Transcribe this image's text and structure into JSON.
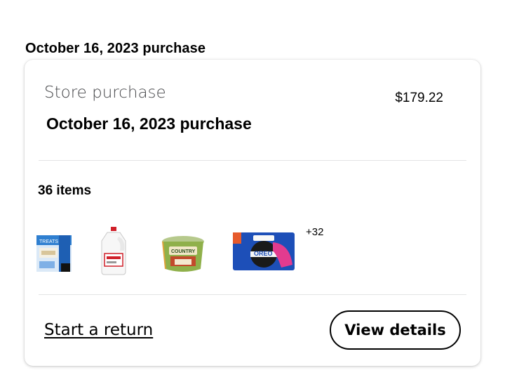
{
  "section": {
    "heading": "October 16, 2023 purchase"
  },
  "order": {
    "purchase_type": "Store purchase",
    "total": "$179.22",
    "title": "October 16, 2023 purchase",
    "items_count": "36 items",
    "more_items": "+32",
    "thumbnails": [
      {
        "name": "Rice Krispies Treats Original",
        "icon": "cereal-bar-box-icon",
        "colors": [
          "#2f7fd0",
          "#dbe9f7"
        ]
      },
      {
        "name": "Milk gallon",
        "icon": "milk-jug-icon",
        "colors": [
          "#ffffff",
          "#d0202a"
        ]
      },
      {
        "name": "Country Crock spread",
        "icon": "butter-tub-icon",
        "colors": [
          "#7aa23a",
          "#c8b88a"
        ]
      },
      {
        "name": "Oreo Double Stuf",
        "icon": "cookie-pack-icon",
        "colors": [
          "#1d4fb8",
          "#e23b8f"
        ]
      }
    ]
  },
  "actions": {
    "start_return": "Start a return",
    "view_details": "View details"
  }
}
